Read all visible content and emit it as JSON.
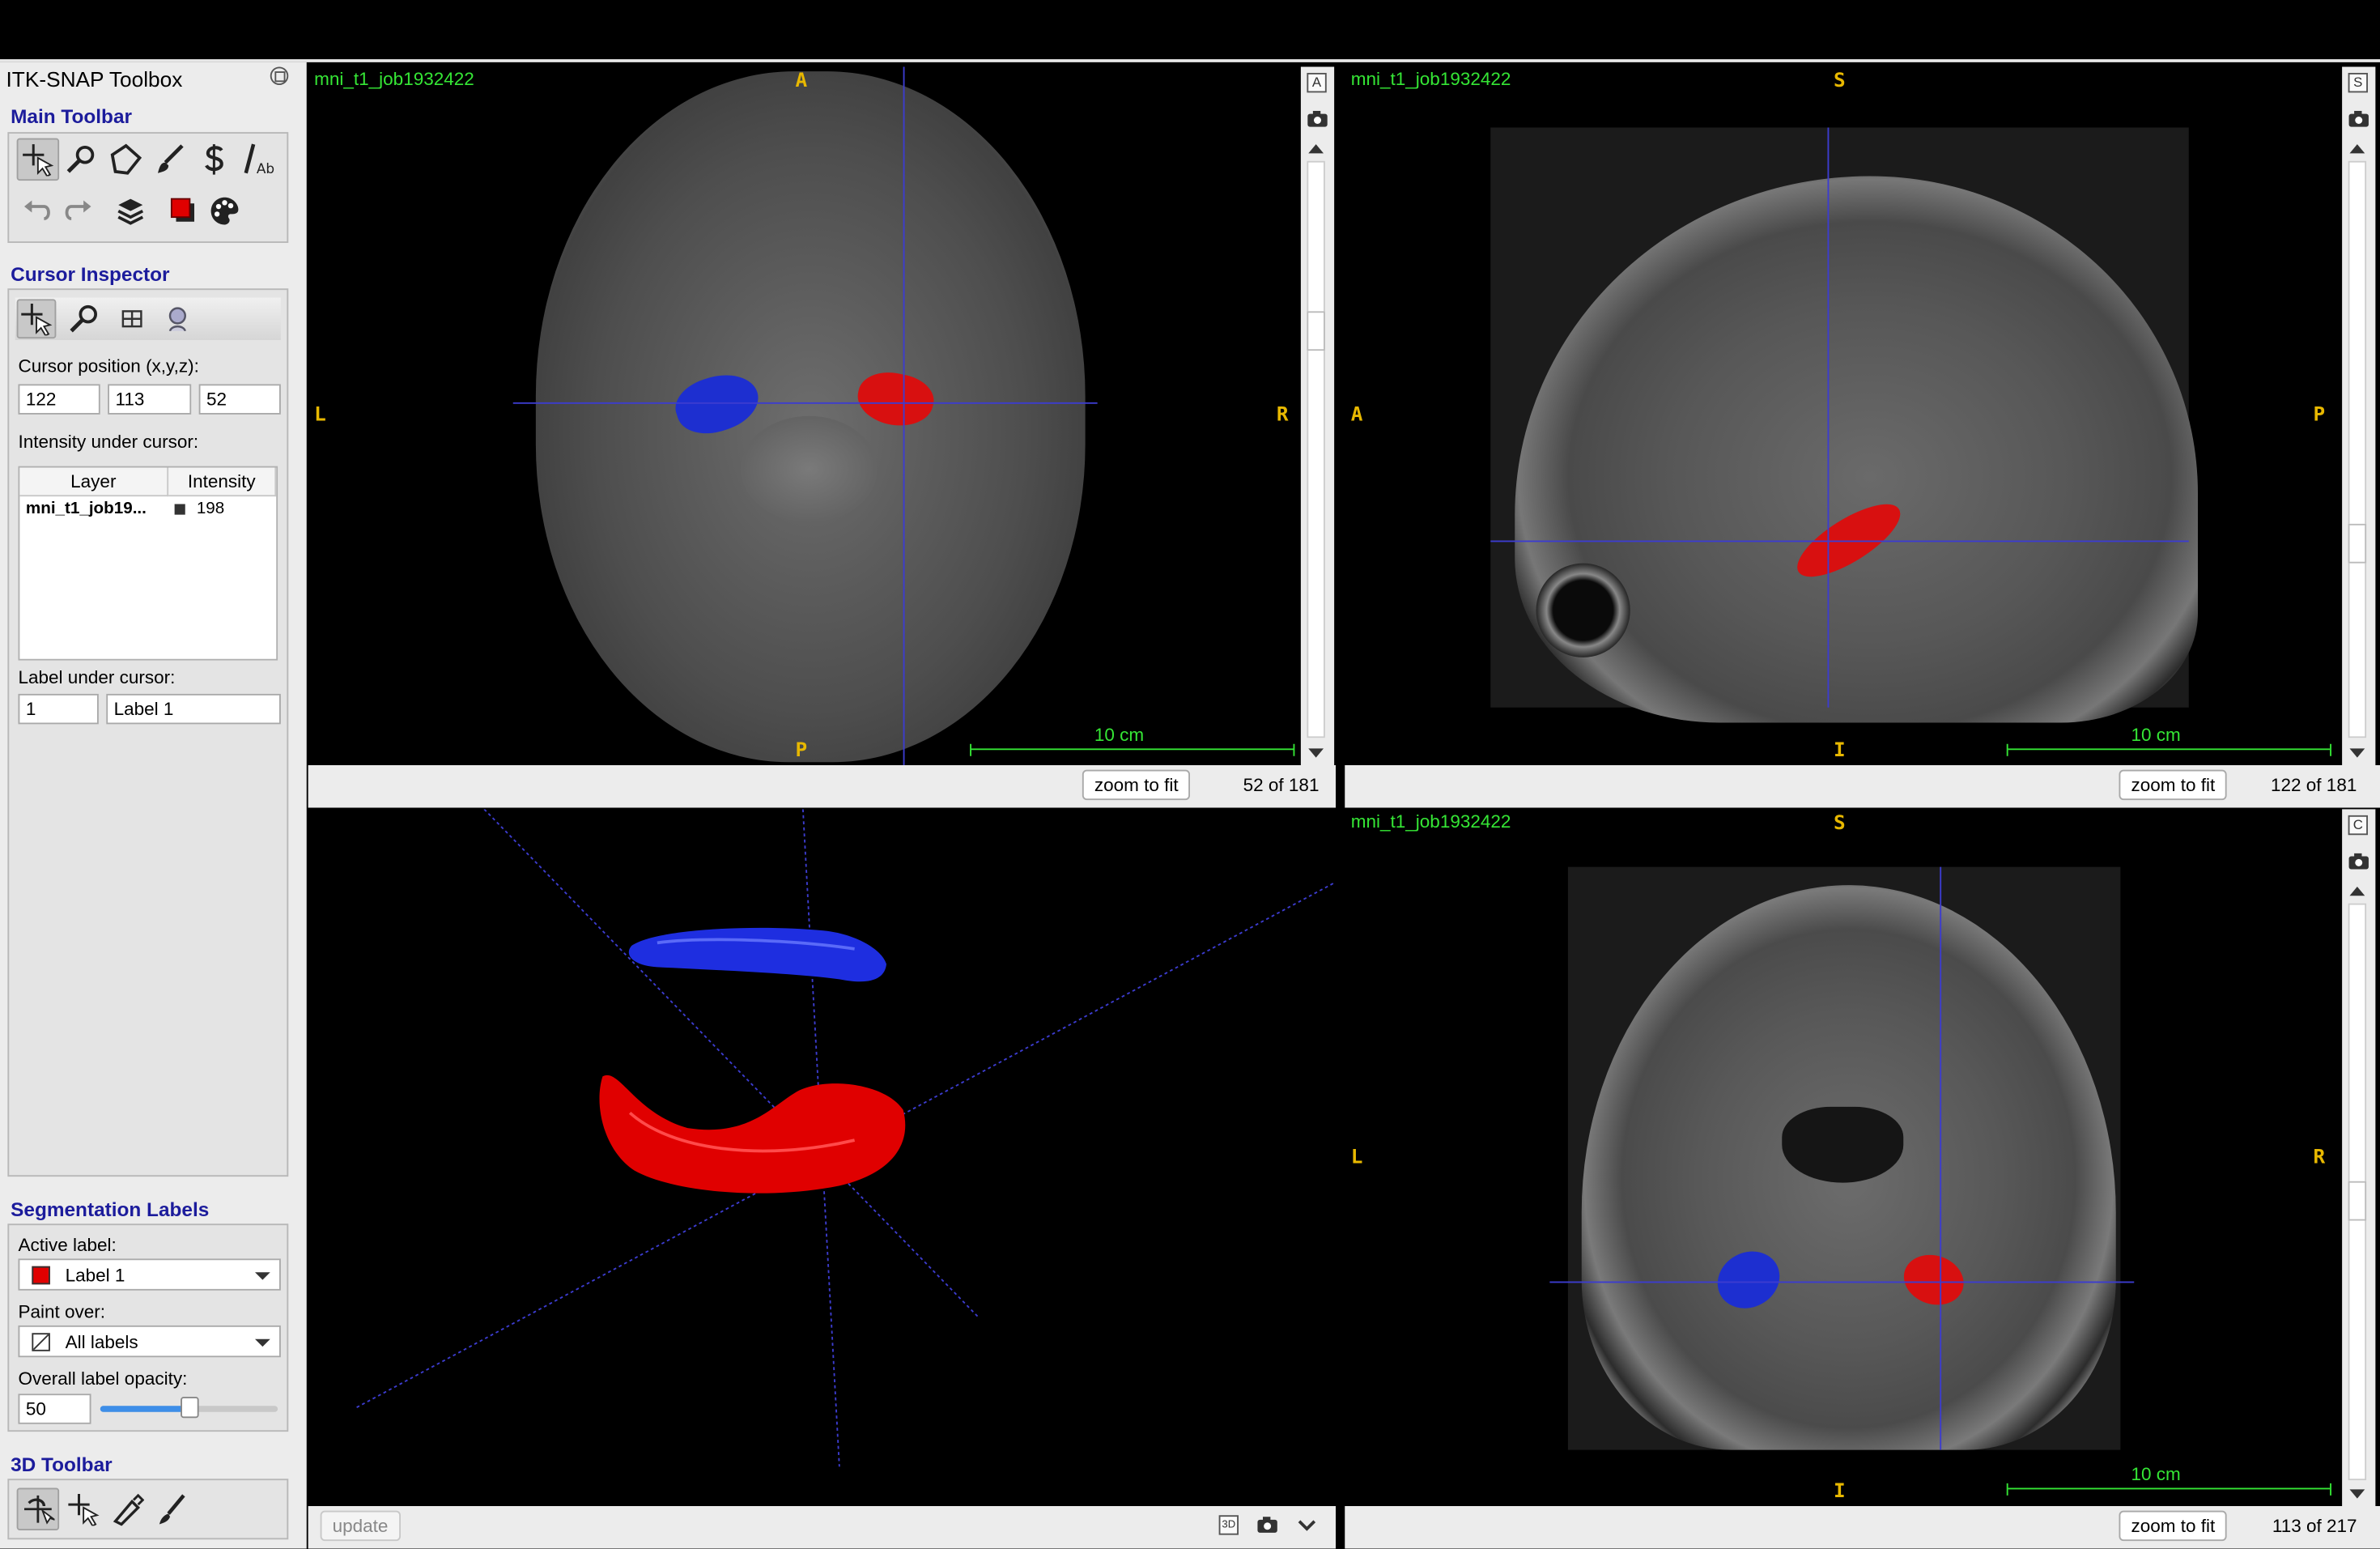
{
  "window": {
    "title": "ITK-SNAP Toolbox"
  },
  "main_toolbar": {
    "title": "Main Toolbar"
  },
  "cursor_inspector": {
    "title": "Cursor Inspector",
    "position_label": "Cursor position (x,y,z):",
    "x": "122",
    "y": "113",
    "z": "52",
    "intensity_label": "Intensity under cursor:",
    "table_headers": [
      "Layer",
      "Intensity"
    ],
    "rows": [
      {
        "layer": "mni_t1_job19...",
        "intensity": "198"
      }
    ],
    "label_under_cursor_label": "Label under cursor:",
    "label_id": "1",
    "label_name": "Label 1"
  },
  "segmentation_labels": {
    "title": "Segmentation Labels",
    "active_label_label": "Active label:",
    "active_label": "Label 1",
    "active_label_color": "#e00000",
    "paint_over_label": "Paint over:",
    "paint_over": "All labels",
    "opacity_label": "Overall label opacity:",
    "opacity": "50",
    "opacity_fraction": 0.5
  },
  "toolbar_3d": {
    "title": "3D Toolbar",
    "update_label": "update"
  },
  "views": {
    "axial": {
      "image_name": "mni_t1_job1932422",
      "top": "A",
      "bottom": "P",
      "left": "L",
      "right": "R",
      "scale": "10 cm",
      "zoom": "zoom to fit",
      "slice": "52 of 181",
      "corner": "A"
    },
    "sagittal": {
      "image_name": "mni_t1_job1932422",
      "top": "S",
      "bottom": "I",
      "left": "A",
      "right": "P",
      "scale": "10 cm",
      "zoom": "zoom to fit",
      "slice": "122 of 181",
      "corner": "S"
    },
    "coronal": {
      "image_name": "mni_t1_job1932422",
      "top": "S",
      "bottom": "I",
      "left": "L",
      "right": "R",
      "scale": "10 cm",
      "zoom": "zoom to fit",
      "slice": "113 of 217",
      "corner": "C"
    },
    "render3d": {
      "corner": "3D"
    }
  },
  "colors": {
    "label_red": "#e00000",
    "label_blue": "#2030d0",
    "overlay_green": "#35e635",
    "orientation": "#e8b800",
    "section_title": "#1c1c9c"
  }
}
